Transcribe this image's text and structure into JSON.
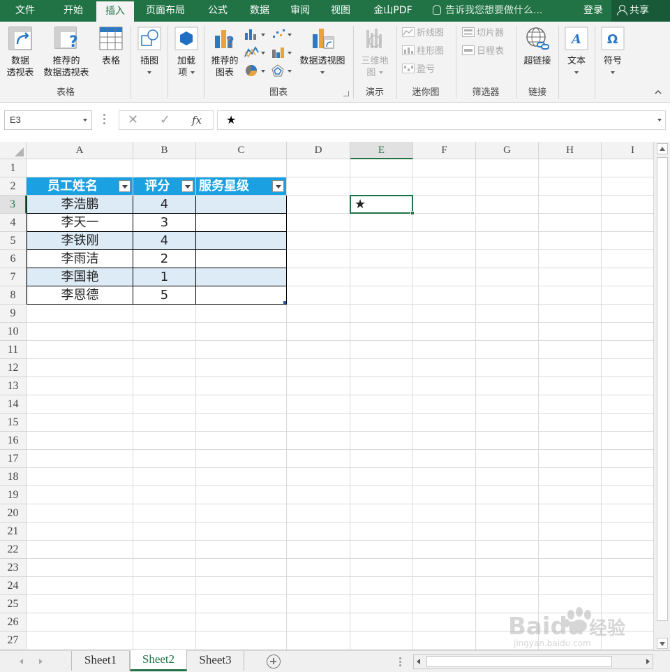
{
  "ribbon_tabs": [
    {
      "label": "文件",
      "active": false
    },
    {
      "label": "开始",
      "active": false
    },
    {
      "label": "插入",
      "active": true
    },
    {
      "label": "页面布局",
      "active": false
    },
    {
      "label": "公式",
      "active": false
    },
    {
      "label": "数据",
      "active": false
    },
    {
      "label": "审阅",
      "active": false
    },
    {
      "label": "视图",
      "active": false
    },
    {
      "label": "金山PDF",
      "active": false
    }
  ],
  "tellme": "告诉我您想要做什么...",
  "login": "登录",
  "share": "共享",
  "ribbon": {
    "pivot_table": [
      "数据",
      "透视表"
    ],
    "recommended_pivot": [
      "推荐的",
      "数据透视表"
    ],
    "table": "表格",
    "group_tables": "表格",
    "illustrations": "插图",
    "addins": [
      "加载",
      "项"
    ],
    "recommended_charts": [
      "推荐的",
      "图表"
    ],
    "pivot_chart": "数据透视图",
    "group_charts": "图表",
    "map3d": [
      "三维地",
      "图"
    ],
    "group_tours": "演示",
    "sparkline_line": "折线图",
    "sparkline_column": "柱形图",
    "sparkline_winloss": "盈亏",
    "group_sparklines": "迷你图",
    "slicer": "切片器",
    "timeline": "日程表",
    "group_filters": "筛选器",
    "hyperlink": "超链接",
    "group_links": "链接",
    "text": "文本",
    "symbols": "符号"
  },
  "formula_bar": {
    "name_box": "E3",
    "cancel": "✕",
    "enter": "✓",
    "fx": "fx",
    "content": "★"
  },
  "grid": {
    "columns": [
      "A",
      "B",
      "C",
      "D",
      "E",
      "F",
      "G",
      "H",
      "I"
    ],
    "rows": [
      "1",
      "2",
      "3",
      "4",
      "5",
      "6",
      "7",
      "8",
      "9",
      "10",
      "11",
      "12",
      "13",
      "14",
      "15",
      "16",
      "17",
      "18",
      "19",
      "20",
      "21",
      "22",
      "23",
      "24",
      "25",
      "26",
      "27"
    ],
    "selected_column": "E",
    "selected_row": "3",
    "table_headers": [
      "员工姓名",
      "评分",
      "服务星级"
    ],
    "table_rows": [
      [
        "李浩鹏",
        "4",
        ""
      ],
      [
        "李天一",
        "3",
        ""
      ],
      [
        "李铁刚",
        "4",
        ""
      ],
      [
        "李雨洁",
        "2",
        ""
      ],
      [
        "李国艳",
        "1",
        ""
      ],
      [
        "李恩德",
        "5",
        ""
      ]
    ],
    "selected_cell_value": "★"
  },
  "sheets": [
    {
      "label": "Sheet1",
      "active": false
    },
    {
      "label": "Sheet2",
      "active": true
    },
    {
      "label": "Sheet3",
      "active": false
    }
  ],
  "watermark": {
    "brand": "Baidu",
    "cn": "经验",
    "url": "jingyan.baidu.com"
  },
  "colors": {
    "accent": "#217346",
    "table_header": "#1ba1e2",
    "band": "#ddebf7"
  }
}
